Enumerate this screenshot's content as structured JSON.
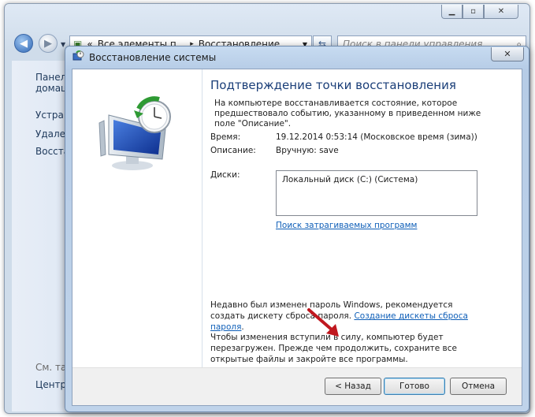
{
  "background_window": {
    "address_prefix": "«",
    "address_part1": "Все элементы п...",
    "address_sep": "▸",
    "address_part2": "Восстановление",
    "search_placeholder": "Поиск в панели управления",
    "sidebar": [
      {
        "label": "Панель"
      },
      {
        "label": "домаш"
      },
      {
        "label": "Устран"
      },
      {
        "label": "Удален"
      },
      {
        "label": "Восстан"
      },
      {
        "label": "См. так"
      },
      {
        "label": "Центр"
      }
    ]
  },
  "dialog": {
    "title": "Восстановление системы",
    "heading": "Подтверждение точки восстановления",
    "intro": "На компьютере восстанавливается состояние, которое предшествовало событию, указанному в приведенном ниже поле \"Описание\".",
    "time_label": "Время:",
    "time_value": "19.12.2014 0:53:14 (Московское время (зима))",
    "description_label": "Описание:",
    "description_value": "Вручную: save",
    "disks_label": "Диски:",
    "disks": [
      "Локальный диск (C:) (Система)"
    ],
    "affected_programs_link": "Поиск затрагиваемых программ",
    "password_note": "Недавно был изменен пароль Windows, рекомендуется создать дискету сброса пароля.",
    "password_link": "Создание дискеты сброса пароля",
    "password_link_suffix": ".",
    "restart_note": "Чтобы изменения вступили в силу, компьютер будет перезагружен. Прежде чем продолжить, сохраните все открытые файлы и закройте все программы.",
    "buttons": {
      "back": "< Назад",
      "finish": "Готово",
      "cancel": "Отмена"
    }
  },
  "colors": {
    "heading": "#1a3e78",
    "link": "#0f5fb8",
    "annotation_arrow": "#c0181f"
  },
  "icons": {
    "restore_icon": "system-restore-clock-monitor",
    "arrow": "red-pointer-arrow"
  }
}
